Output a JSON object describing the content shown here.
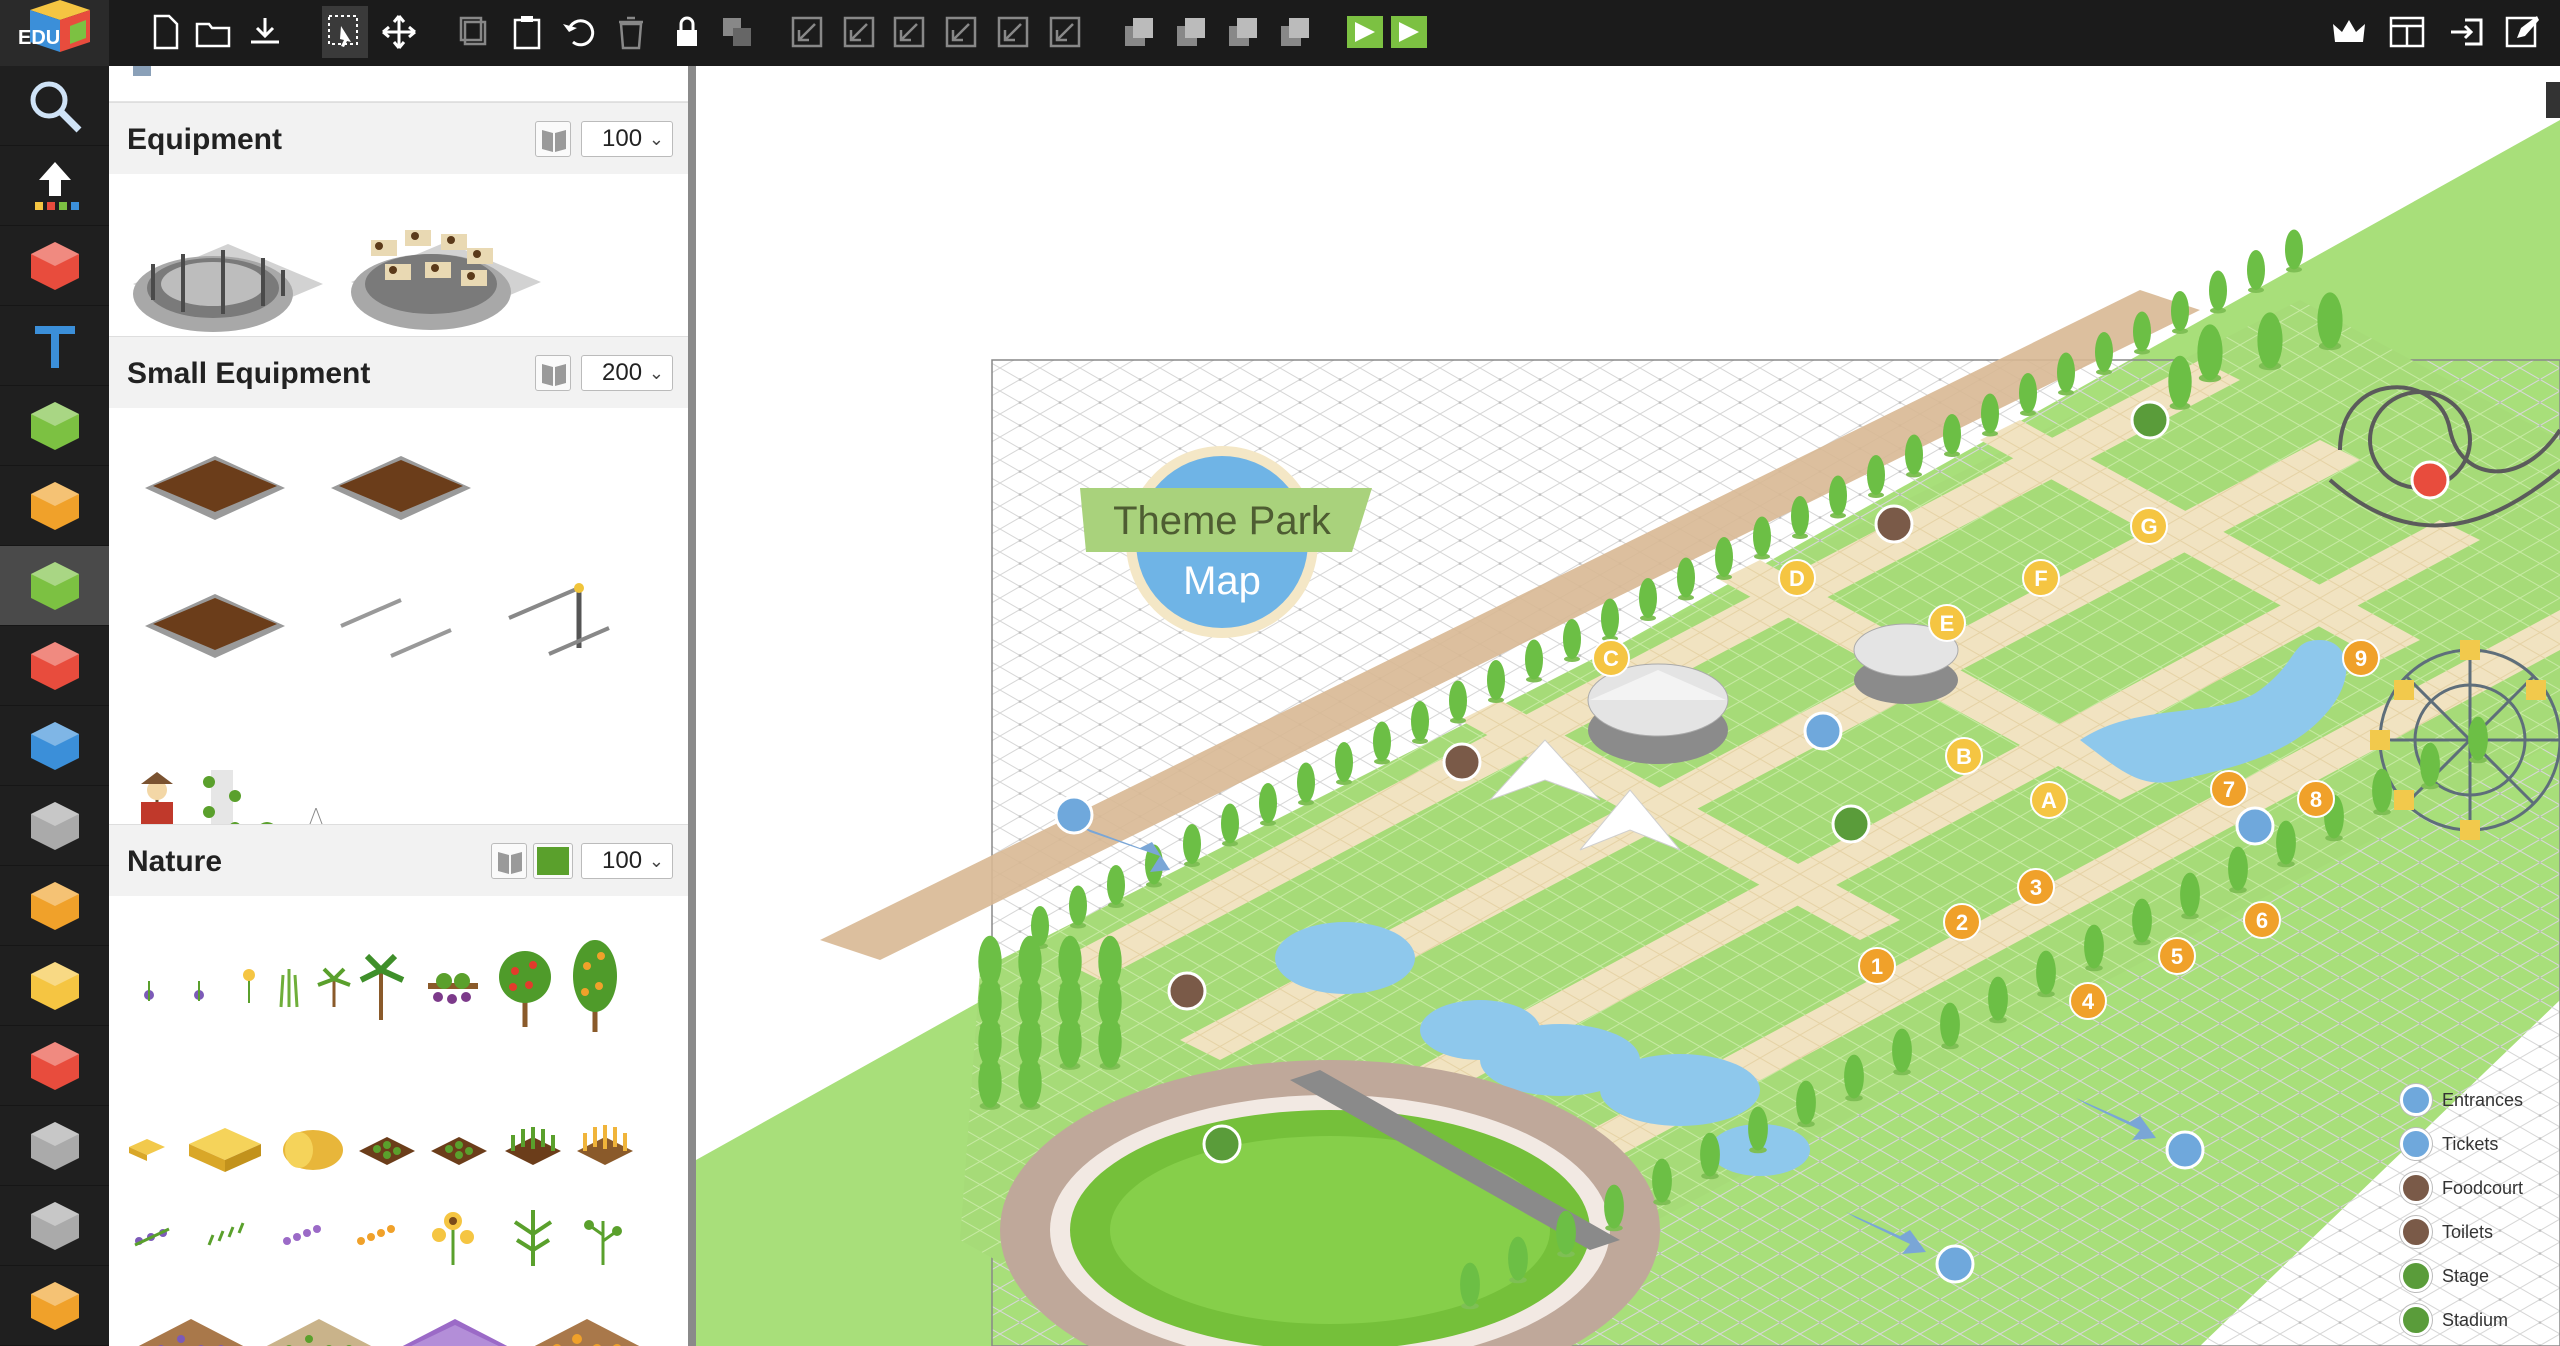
{
  "app": {
    "logo_text": "EDU"
  },
  "toolbar": {
    "buttons": [
      {
        "name": "new-document-icon"
      },
      {
        "name": "open-folder-icon"
      },
      {
        "name": "save-icon"
      },
      {
        "name": "select-icon"
      },
      {
        "name": "move-icon"
      },
      {
        "name": "copy-icon"
      },
      {
        "name": "paste-icon"
      },
      {
        "name": "undo-icon"
      },
      {
        "name": "delete-icon"
      },
      {
        "name": "lock-icon"
      },
      {
        "name": "group-icon"
      },
      {
        "name": "align-bottom-left-icon"
      },
      {
        "name": "align-bottom-right-icon"
      },
      {
        "name": "align-top-left-icon"
      },
      {
        "name": "align-top-right-icon"
      },
      {
        "name": "align-up-icon"
      },
      {
        "name": "align-down-icon"
      },
      {
        "name": "bring-to-front-icon"
      },
      {
        "name": "send-to-back-icon"
      },
      {
        "name": "bring-forward-icon"
      },
      {
        "name": "send-backward-icon"
      },
      {
        "name": "play-icon"
      },
      {
        "name": "play-all-icon"
      },
      {
        "name": "crown-icon"
      },
      {
        "name": "layout-icon"
      },
      {
        "name": "login-icon"
      },
      {
        "name": "edit-icon"
      }
    ]
  },
  "categories": [
    "search-icon",
    "upload-icon",
    "shapes-icon",
    "text-icon",
    "buildings-icon",
    "sports-icon",
    "park-icon",
    "furniture-icon",
    "library-icon",
    "transport-icon",
    "airplane-icon",
    "construction-icon",
    "industry-icon",
    "energy-icon",
    "robot-icon",
    "picture-icon"
  ],
  "library": {
    "sections": [
      {
        "title": "Equipment",
        "size": "100",
        "has_color": false
      },
      {
        "title": "Small Equipment",
        "size": "200",
        "has_color": false
      },
      {
        "title": "Nature",
        "size": "100",
        "has_color": true,
        "color": "#5aa02c"
      }
    ]
  },
  "map": {
    "title_line1": "Theme Park",
    "title_line2": "Map",
    "attractions": [
      "1",
      "2",
      "3",
      "4",
      "5",
      "6",
      "7",
      "8",
      "9",
      "A",
      "B",
      "C",
      "D",
      "E",
      "F",
      "G"
    ]
  },
  "legend": {
    "items": [
      {
        "label": "Entrances",
        "color": "#6fa8dc",
        "icon": "entrance-icon"
      },
      {
        "label": "Tickets",
        "color": "#6fa8dc",
        "icon": "ticket-icon"
      },
      {
        "label": "Foodcourt",
        "color": "#7a5a48",
        "icon": "food-icon"
      },
      {
        "label": "Toilets",
        "color": "#7a5a48",
        "icon": "toilet-icon"
      },
      {
        "label": "Stage",
        "color": "#5a9c3a",
        "icon": "stage-icon"
      },
      {
        "label": "Stadium",
        "color": "#5a9c3a",
        "icon": "stadium-icon"
      }
    ]
  },
  "colors": {
    "accent": "#7cc142",
    "path_beige": "#e8d6b0",
    "grass": "#8ccf5a",
    "water": "#8ec3e8",
    "badge_orange": "#f0a12a"
  }
}
